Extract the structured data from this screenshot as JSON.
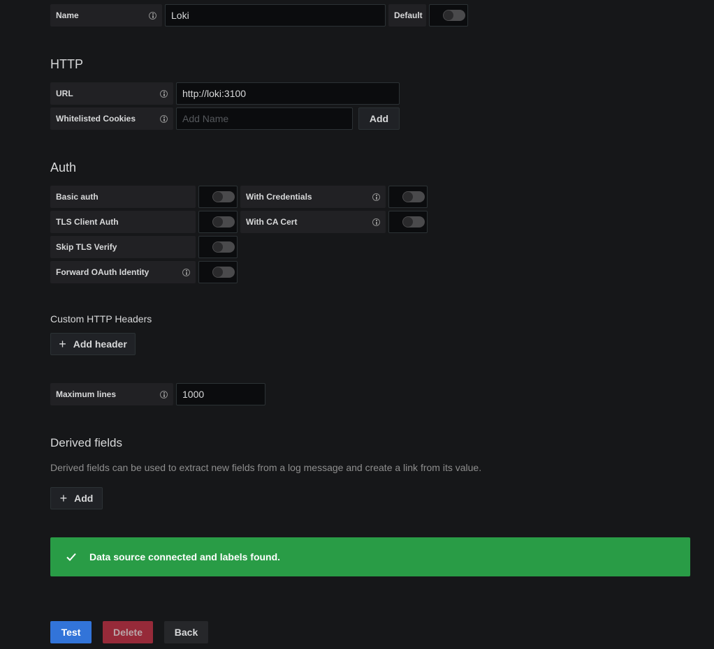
{
  "name_row": {
    "label": "Name",
    "value": "Loki",
    "default_label": "Default",
    "default_on": false
  },
  "http": {
    "title": "HTTP",
    "url_label": "URL",
    "url_value": "http://loki:3100",
    "cookies_label": "Whitelisted Cookies",
    "cookies_placeholder": "Add Name",
    "cookies_add_label": "Add"
  },
  "auth": {
    "title": "Auth",
    "items": [
      {
        "label": "Basic auth",
        "on": false
      },
      {
        "label": "With Credentials",
        "on": false
      },
      {
        "label": "TLS Client Auth",
        "on": false
      },
      {
        "label": "With CA Cert",
        "on": false
      },
      {
        "label": "Skip TLS Verify",
        "on": false
      },
      {
        "label": "Forward OAuth Identity",
        "on": false
      }
    ]
  },
  "headers": {
    "title": "Custom HTTP Headers",
    "add_label": "Add header"
  },
  "max_lines": {
    "label": "Maximum lines",
    "value": "1000"
  },
  "derived": {
    "title": "Derived fields",
    "description": "Derived fields can be used to extract new fields from a log message and create a link from its value.",
    "add_label": "Add"
  },
  "alert": {
    "message": "Data source connected and labels found.",
    "color": "#299c46"
  },
  "actions": {
    "test_label": "Test",
    "delete_label": "Delete",
    "back_label": "Back",
    "test_color": "#3274d9",
    "delete_color": "#962a39"
  }
}
